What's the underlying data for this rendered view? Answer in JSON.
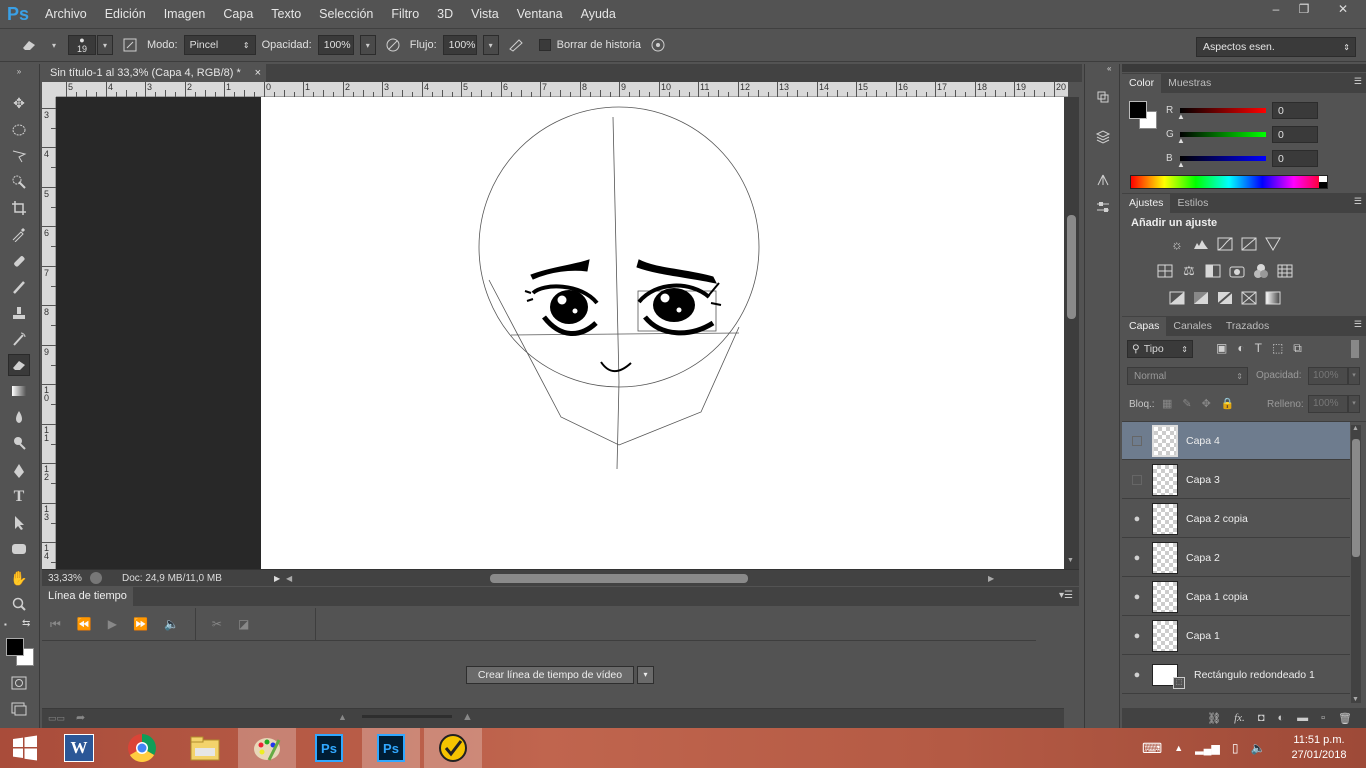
{
  "app": {
    "logo": "Ps"
  },
  "menu": [
    "Archivo",
    "Edición",
    "Imagen",
    "Capa",
    "Texto",
    "Selección",
    "Filtro",
    "3D",
    "Vista",
    "Ventana",
    "Ayuda"
  ],
  "window_controls": {
    "minimize": "–",
    "restore": "❐",
    "close": "✕"
  },
  "options": {
    "brush_size": "19",
    "mode_label": "Modo:",
    "mode_value": "Pincel",
    "opacity_label": "Opacidad:",
    "opacity_value": "100%",
    "flow_label": "Flujo:",
    "flow_value": "100%",
    "erase_history_label": "Borrar de historia",
    "workspace": "Aspectos esen."
  },
  "document": {
    "tab_title": "Sin título-1 al 33,3% (Capa 4, RGB/8) *",
    "tab_close": "×",
    "zoom": "33,33%",
    "doc_info": "Doc: 24,9 MB/11,0 MB"
  },
  "rulers": {
    "top": [
      "5",
      "4",
      "3",
      "2",
      "1",
      "0",
      "1",
      "2",
      "3",
      "4",
      "5",
      "6",
      "7",
      "8",
      "9",
      "10",
      "11",
      "12",
      "13",
      "14",
      "15",
      "16",
      "17",
      "18",
      "19",
      "20"
    ],
    "left": [
      "3",
      "4",
      "5",
      "6",
      "7",
      "8",
      "9",
      "1 0",
      "1 1",
      "1 2",
      "1 3",
      "1 4"
    ]
  },
  "timeline": {
    "title": "Línea de tiempo",
    "create_button": "Crear línea de tiempo de vídeo"
  },
  "color_panel": {
    "tabs": [
      "Color",
      "Muestras"
    ],
    "channels": [
      {
        "label": "R",
        "value": "0",
        "color": "#d01010"
      },
      {
        "label": "G",
        "value": "0",
        "color": "#10b010"
      },
      {
        "label": "B",
        "value": "0",
        "color": "#1010d0"
      }
    ]
  },
  "adjustments_panel": {
    "tabs": [
      "Ajustes",
      "Estilos"
    ],
    "heading": "Añadir un ajuste",
    "icons": [
      "brightness-icon",
      "levels-icon",
      "curves-icon",
      "exposure-icon",
      "gradient-triangle-icon",
      "hsl-icon",
      "color-balance-icon",
      "bw-icon",
      "photo-filter-icon",
      "channel-mixer-icon",
      "color-lookup-icon",
      "invert-icon",
      "posterize-icon",
      "threshold-icon",
      "selective-color-icon",
      "gradient-map-icon"
    ]
  },
  "layers_panel": {
    "tabs": [
      "Capas",
      "Canales",
      "Trazados"
    ],
    "filter_label": "Tipo",
    "blend_mode": "Normal",
    "opacity_label": "Opacidad:",
    "opacity_value": "100%",
    "lock_label": "Bloq.:",
    "fill_label": "Relleno:",
    "fill_value": "100%",
    "layers": [
      {
        "name": "Capa 4",
        "visible": false,
        "selected": true
      },
      {
        "name": "Capa 3",
        "visible": false,
        "selected": false
      },
      {
        "name": "Capa 2 copia",
        "visible": true,
        "selected": false
      },
      {
        "name": "Capa 2",
        "visible": true,
        "selected": false
      },
      {
        "name": "Capa 1 copia",
        "visible": true,
        "selected": false
      },
      {
        "name": "Capa 1",
        "visible": true,
        "selected": false
      },
      {
        "name": "Rectángulo redondeado 1",
        "visible": true,
        "selected": false
      }
    ],
    "footer_fx": "fx."
  },
  "taskbar": {
    "apps": [
      "windows-start",
      "word",
      "chrome",
      "file-explorer",
      "paint",
      "photoshop",
      "photoshop-active",
      "norton"
    ],
    "time": "11:51 p.m.",
    "date": "27/01/2018"
  }
}
